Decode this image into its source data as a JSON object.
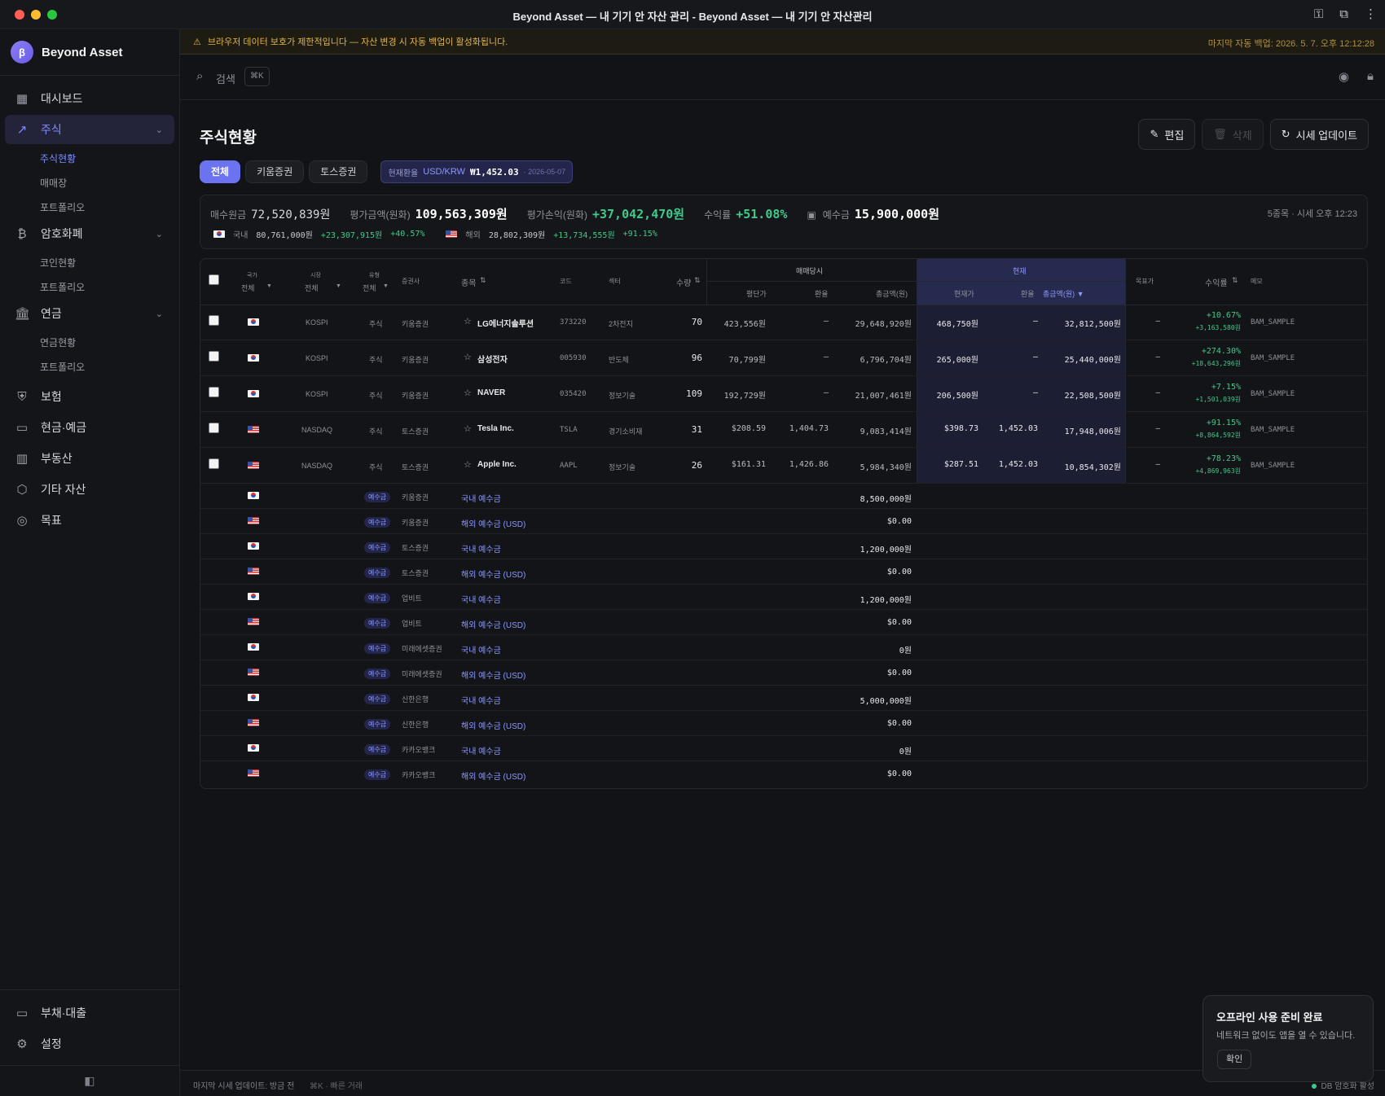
{
  "window": {
    "title": "Beyond Asset — 내 기기 안 자산 관리 - Beyond Asset — 내 기기 안 자산관리"
  },
  "sidebar": {
    "brand": "Beyond Asset",
    "brand_logo": "β",
    "items": [
      {
        "label": "대시보드",
        "icon": "grid-icon"
      },
      {
        "label": "주식",
        "icon": "trend-up-icon",
        "expanded": true,
        "children": [
          "주식현황",
          "매매장",
          "포트폴리오"
        ]
      },
      {
        "label": "암호화폐",
        "icon": "bitcoin-icon",
        "children": [
          "코인현황",
          "포트폴리오"
        ]
      },
      {
        "label": "연금",
        "icon": "bank-icon",
        "children": [
          "연금현황",
          "포트폴리오"
        ]
      },
      {
        "label": "보험",
        "icon": "shield-icon"
      },
      {
        "label": "현금·예금",
        "icon": "cash-icon"
      },
      {
        "label": "부동산",
        "icon": "building-icon"
      },
      {
        "label": "기타 자산",
        "icon": "box-icon"
      },
      {
        "label": "목표",
        "icon": "target-icon"
      }
    ],
    "bottom": [
      {
        "label": "부채·대출",
        "icon": "card-icon"
      },
      {
        "label": "설정",
        "icon": "gear-icon"
      }
    ]
  },
  "banner": {
    "text": "브라우저 데이터 보호가 제한적입니다 — 자산 변경 시 자동 백업이 활성화됩니다.",
    "right": "마지막 자동 백업: 2026. 5. 7. 오후 12:12:28"
  },
  "search": {
    "placeholder": "검색",
    "shortcut": "⌘K"
  },
  "page": {
    "title": "주식현황",
    "actions": {
      "edit": "편집",
      "delete": "삭제",
      "update": "시세 업데이트"
    },
    "tabs": [
      "전체",
      "키움증권",
      "토스증권"
    ],
    "fx": {
      "label": "현재환율",
      "pair": "USD/KRW",
      "rate": "₩1,452.03",
      "date": "· 2026-05-07"
    }
  },
  "summary": {
    "buy_label": "매수원금",
    "buy_value": "72,520,839원",
    "eval_label": "평가금액(원화)",
    "eval_value": "109,563,309원",
    "pl_label": "평가손익(원화)",
    "pl_value": "+37,042,470원",
    "rate_label": "수익률",
    "rate_value": "+51.08%",
    "deposit_label": "예수금",
    "deposit_value": "15,900,000원",
    "right": "5종목 · 시세 오후 12:23",
    "domestic": {
      "label": "국내",
      "value": "80,761,000원",
      "pl": "+23,307,915원",
      "rate": "+40.57%"
    },
    "overseas": {
      "label": "해외",
      "value": "28,802,309원",
      "pl": "+13,734,555원",
      "rate": "+91.15%"
    }
  },
  "table": {
    "headers": {
      "country": "국가",
      "country_filter": "전체",
      "market": "시장",
      "market_filter": "전체",
      "type": "유형",
      "type_filter": "전체",
      "broker": "증권사",
      "name": "종목",
      "code": "코드",
      "sector": "섹터",
      "qty": "수량",
      "group_buy": "매매당시",
      "avg_price": "평단가",
      "buy_fx": "환율",
      "buy_total": "총금액(원)",
      "group_now": "현재",
      "cur_price": "현재가",
      "cur_fx": "환율",
      "cur_total": "총금액(원) ▼",
      "target": "목표가",
      "return": "수익률",
      "memo": "메모"
    },
    "stocks": [
      {
        "country": "kr",
        "market": "KOSPI",
        "type": "주식",
        "broker": "키움증권",
        "name": "LG에너지솔루션",
        "code": "373220",
        "sector": "2차전지",
        "qty": "70",
        "avg": "423,556원",
        "buy_fx": "–",
        "buy_total": "29,648,920원",
        "cur": "468,750원",
        "cur_fx": "–",
        "cur_total": "32,812,500원",
        "target": "–",
        "ret": "+10.67%",
        "ret_amt": "+3,163,580원",
        "memo": "BAM_SAMPLE"
      },
      {
        "country": "kr",
        "market": "KOSPI",
        "type": "주식",
        "broker": "키움증권",
        "name": "삼성전자",
        "code": "005930",
        "sector": "반도체",
        "qty": "96",
        "avg": "70,799원",
        "buy_fx": "–",
        "buy_total": "6,796,704원",
        "cur": "265,000원",
        "cur_fx": "–",
        "cur_total": "25,440,000원",
        "target": "–",
        "ret": "+274.30%",
        "ret_amt": "+18,643,296원",
        "memo": "BAM_SAMPLE"
      },
      {
        "country": "kr",
        "market": "KOSPI",
        "type": "주식",
        "broker": "키움증권",
        "name": "NAVER",
        "code": "035420",
        "sector": "정보기술",
        "qty": "109",
        "avg": "192,729원",
        "buy_fx": "–",
        "buy_total": "21,007,461원",
        "cur": "206,500원",
        "cur_fx": "–",
        "cur_total": "22,508,500원",
        "target": "–",
        "ret": "+7.15%",
        "ret_amt": "+1,501,039원",
        "memo": "BAM_SAMPLE"
      },
      {
        "country": "us",
        "market": "NASDAQ",
        "type": "주식",
        "broker": "토스증권",
        "name": "Tesla Inc.",
        "code": "TSLA",
        "sector": "경기소비재",
        "qty": "31",
        "avg": "$208.59",
        "buy_fx": "1,404.73",
        "buy_total": "9,083,414원",
        "cur": "$398.73",
        "cur_fx": "1,452.03",
        "cur_total": "17,948,006원",
        "target": "–",
        "ret": "+91.15%",
        "ret_amt": "+8,864,592원",
        "memo": "BAM_SAMPLE"
      },
      {
        "country": "us",
        "market": "NASDAQ",
        "type": "주식",
        "broker": "토스증권",
        "name": "Apple Inc.",
        "code": "AAPL",
        "sector": "정보기술",
        "qty": "26",
        "avg": "$161.31",
        "buy_fx": "1,426.86",
        "buy_total": "5,984,340원",
        "cur": "$287.51",
        "cur_fx": "1,452.03",
        "cur_total": "10,854,302원",
        "target": "–",
        "ret": "+78.23%",
        "ret_amt": "+4,869,963원",
        "memo": "BAM_SAMPLE"
      }
    ],
    "deposits": [
      {
        "country": "kr",
        "badge": "예수금",
        "broker": "키움증권",
        "name": "국내 예수금",
        "amount": "8,500,000원"
      },
      {
        "country": "us",
        "badge": "예수금",
        "broker": "키움증권",
        "name": "해외 예수금 (USD)",
        "amount": "$0.00"
      },
      {
        "country": "kr",
        "badge": "예수금",
        "broker": "토스증권",
        "name": "국내 예수금",
        "amount": "1,200,000원"
      },
      {
        "country": "us",
        "badge": "예수금",
        "broker": "토스증권",
        "name": "해외 예수금 (USD)",
        "amount": "$0.00"
      },
      {
        "country": "kr",
        "badge": "예수금",
        "broker": "업비트",
        "name": "국내 예수금",
        "amount": "1,200,000원"
      },
      {
        "country": "us",
        "badge": "예수금",
        "broker": "업비트",
        "name": "해외 예수금 (USD)",
        "amount": "$0.00"
      },
      {
        "country": "kr",
        "badge": "예수금",
        "broker": "미래에셋증권",
        "name": "국내 예수금",
        "amount": "0원"
      },
      {
        "country": "us",
        "badge": "예수금",
        "broker": "미래에셋증권",
        "name": "해외 예수금 (USD)",
        "amount": "$0.00"
      },
      {
        "country": "kr",
        "badge": "예수금",
        "broker": "신한은행",
        "name": "국내 예수금",
        "amount": "5,000,000원"
      },
      {
        "country": "us",
        "badge": "예수금",
        "broker": "신한은행",
        "name": "해외 예수금 (USD)",
        "amount": "$0.00"
      },
      {
        "country": "kr",
        "badge": "예수금",
        "broker": "카카오뱅크",
        "name": "국내 예수금",
        "amount": "0원"
      },
      {
        "country": "us",
        "badge": "예수금",
        "broker": "카카오뱅크",
        "name": "해외 예수금 (USD)",
        "amount": "$0.00"
      }
    ]
  },
  "toast": {
    "title": "오프라인 사용 준비 완료",
    "body": "네트워크 없이도 앱을 열 수 있습니다.",
    "ok": "확인"
  },
  "status": {
    "left": "마지막 시세 업데이트: 방금 전",
    "hint": "⌘K · 빠른 거래",
    "right": "DB 암호화 활성"
  },
  "colors": {
    "accent": "#6c73f0",
    "positive": "#3fca8b",
    "warning": "#e0b54a"
  }
}
